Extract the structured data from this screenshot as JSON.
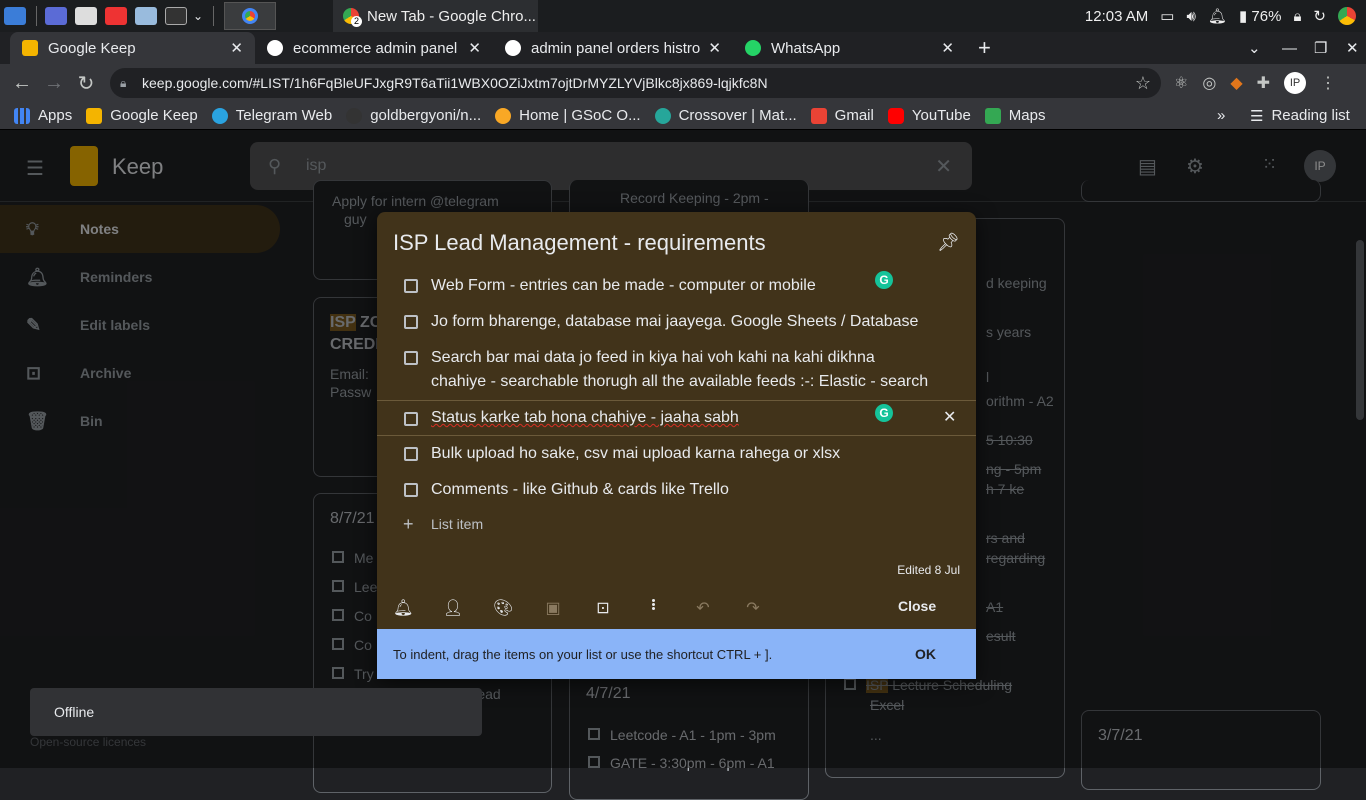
{
  "taskbar": {
    "window_title": "New Tab - Google Chro...",
    "clock": "12:03 AM",
    "battery": "76%",
    "badge": "2"
  },
  "tabs": [
    {
      "label": "Google Keep",
      "color": "#f4b400"
    },
    {
      "label": "ecommerce admin panel n",
      "color": "#ffffff"
    },
    {
      "label": "admin panel orders histro",
      "color": "#ffffff"
    },
    {
      "label": "WhatsApp",
      "color": "#25d366"
    }
  ],
  "address": {
    "url": "keep.google.com/#LIST/1h6FqBleUFJxgR9T6aTii1WBX0OZiJxtm7ojtDrMYZLYVjBlkc8jx869-lqjkfc8N"
  },
  "bookmarks": [
    {
      "label": "Apps",
      "color": "#4285f4"
    },
    {
      "label": "Google Keep",
      "color": "#f4b400"
    },
    {
      "label": "Telegram Web",
      "color": "#2aa3e0"
    },
    {
      "label": "goldbergyoni/n...",
      "color": "#333333"
    },
    {
      "label": "Home | GSoC O...",
      "color": "#f9a825"
    },
    {
      "label": "Crossover | Mat...",
      "color": "#26a69a"
    },
    {
      "label": "Gmail",
      "color": "#ea4335"
    },
    {
      "label": "YouTube",
      "color": "#ff0000"
    },
    {
      "label": "Maps",
      "color": "#34a853"
    }
  ],
  "reading_list": "Reading list",
  "more_bookmarks": "»",
  "keep": {
    "app_name": "Keep",
    "search_value": "isp",
    "avatar": "IP",
    "sidebar": [
      {
        "label": "Notes",
        "icon": "bulb"
      },
      {
        "label": "Reminders",
        "icon": "bell"
      },
      {
        "label": "Edit labels",
        "icon": "pencil"
      },
      {
        "label": "Archive",
        "icon": "archive"
      },
      {
        "label": "Bin",
        "icon": "trash"
      }
    ],
    "footer_link": "Open-source licences"
  },
  "bg": {
    "col1_top": "Apply for intern @telegram",
    "col1_top2": "guy",
    "col1_card2_title": "ZC",
    "col1_card2_title2": "CREDE",
    "col1_card2_tag": "ISP",
    "col1_card2_email": "Email:",
    "col1_card2_pass": "Passw",
    "col1_card3_date": "8/7/21",
    "col1_card3_items": [
      "Me",
      "Lee",
      "Co",
      "Co",
      "Try"
    ],
    "col1_card3_extra": "so read",
    "col2_top": "Record Keeping - 2pm -",
    "col2_date": "4/7/21",
    "col2_items": [
      "Leetcode - A1 - 1pm - 3pm",
      "GATE - 3:30pm - 6pm - A1"
    ],
    "col3_lines": [
      "d keeping",
      "s years",
      "l",
      "orithm - A2",
      "5 10:30",
      "ng - 5pm",
      "h 7 ke",
      "rs and",
      "regarding",
      "A1",
      "esult",
      "Lecture Scheduling",
      "Excel",
      "..."
    ],
    "col3_tag": "ISP",
    "col4_date": "3/7/21"
  },
  "note": {
    "title": "ISP Lead Management - requirements",
    "items": [
      {
        "text": "Web Form - entries can be made - computer or mobile"
      },
      {
        "text": "Jo form bharenge, database mai jaayega. Google Sheets / Database"
      },
      {
        "text": "Search bar mai data jo feed in kiya hai voh kahi na kahi dikhna chahiye - searchable thorugh all the available feeds :-: Elastic - search"
      },
      {
        "text": "Status karke tab hona chahiye - jaaha sabh"
      },
      {
        "text": "Bulk upload ho sake, csv mai upload karna rahega or xlsx"
      },
      {
        "text": "Comments - like Github & cards like Trello"
      }
    ],
    "add_item": "List item",
    "edited": "Edited 8 Jul",
    "close": "Close",
    "grammarly": "G"
  },
  "snackbar": {
    "message": "To indent, drag the items on your list or use the shortcut CTRL + ].",
    "ok": "OK"
  },
  "toast": {
    "message": "Offline"
  },
  "colors": {
    "note_bg": "#41331a",
    "snackbar": "#8ab4f8",
    "grammarly": "#15c39a"
  }
}
